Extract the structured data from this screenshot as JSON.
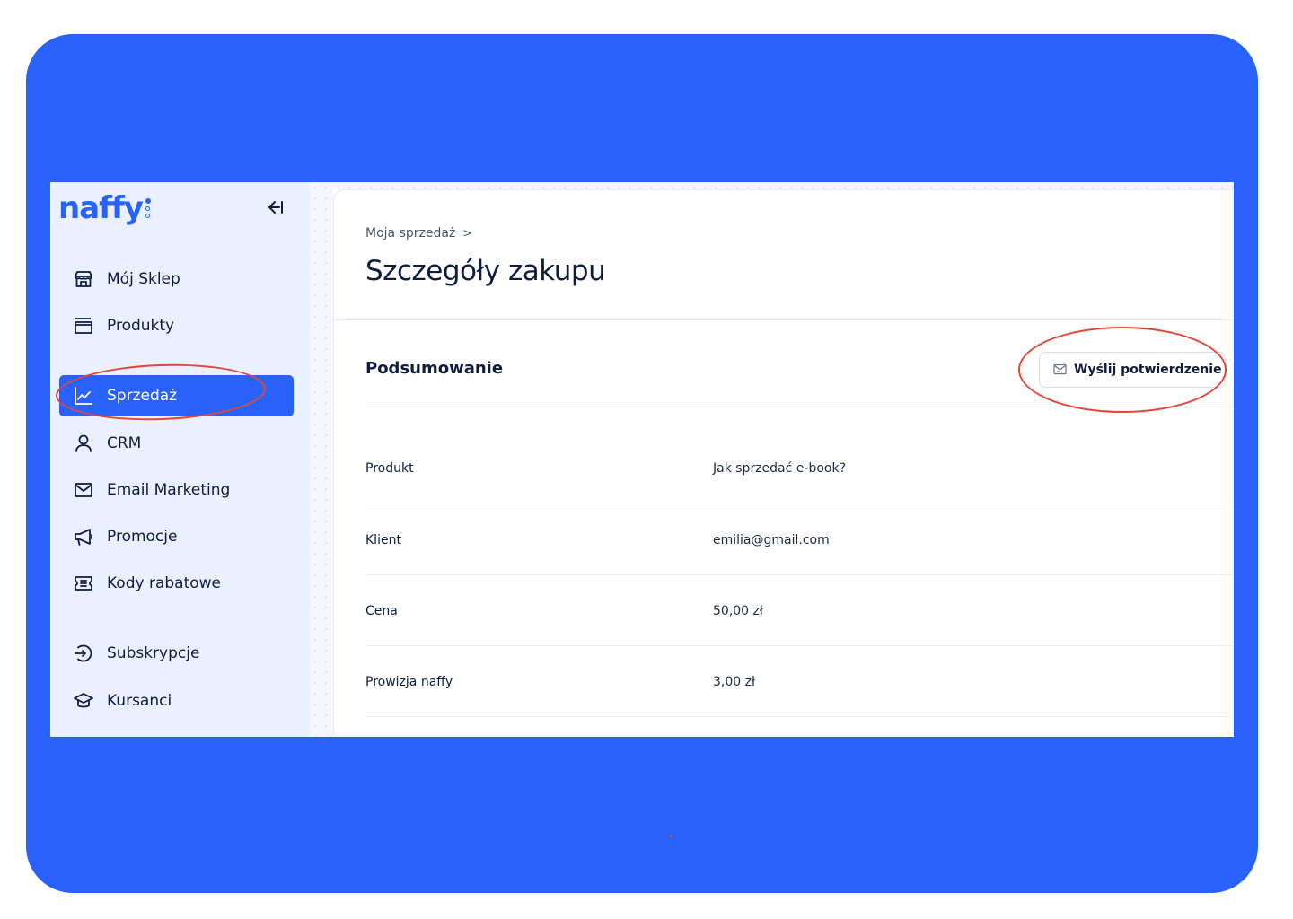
{
  "app": {
    "logo_text": "naffy",
    "brand_color": "#2962fb",
    "accent_annotation_color": "#e0473a"
  },
  "sidebar": {
    "collapse_icon": "collapse-left-icon",
    "items": [
      {
        "label": "Mój Sklep",
        "icon": "store-icon",
        "active": false
      },
      {
        "label": "Produkty",
        "icon": "folder-icon",
        "active": false
      },
      {
        "label": "Sprzedaż",
        "icon": "chart-line-icon",
        "active": true
      },
      {
        "label": "CRM",
        "icon": "user-icon",
        "active": false
      },
      {
        "label": "Email Marketing",
        "icon": "mail-icon",
        "active": false
      },
      {
        "label": "Promocje",
        "icon": "megaphone-icon",
        "active": false
      },
      {
        "label": "Kody rabatowe",
        "icon": "ticket-icon",
        "active": false
      },
      {
        "label": "Subskrypcje",
        "icon": "subscription-icon",
        "active": false
      },
      {
        "label": "Kursanci",
        "icon": "graduation-cap-icon",
        "active": false
      }
    ]
  },
  "main": {
    "breadcrumb": {
      "link": "Moja sprzedaż",
      "separator": ">"
    },
    "title": "Szczegóły zakupu",
    "section_title": "Podsumowanie",
    "send_button": {
      "label": "Wyślij potwierdzenie",
      "icon": "mail-send-icon"
    },
    "details": [
      {
        "label": "Produkt",
        "value": "Jak sprzedać e-book?"
      },
      {
        "label": "Klient",
        "value": "emilia@gmail.com"
      },
      {
        "label": "Cena",
        "value": "50,00 zł"
      },
      {
        "label": "Prowizja naffy",
        "value": "3,00 zł"
      }
    ]
  }
}
